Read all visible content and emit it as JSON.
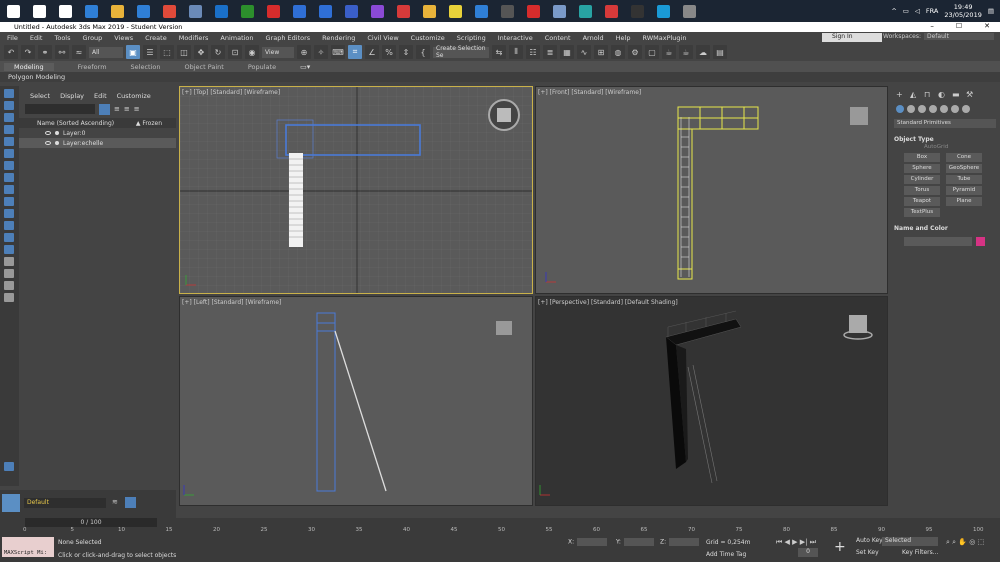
{
  "taskbar": {
    "apps": [
      {
        "icon": "windows-start-icon",
        "color": "#ffffff"
      },
      {
        "icon": "search-icon",
        "color": "#ffffff"
      },
      {
        "icon": "task-view-icon",
        "color": "#ffffff"
      },
      {
        "icon": "edge-icon",
        "color": "#2f7fd6"
      },
      {
        "icon": "file-explorer-icon",
        "color": "#e8b33a"
      },
      {
        "icon": "store-icon",
        "color": "#2f7fd6"
      },
      {
        "icon": "chrome-icon",
        "color": "#e04a3a"
      },
      {
        "icon": "photos-icon",
        "color": "#6a8ab8"
      },
      {
        "icon": "outlook-icon",
        "color": "#1a70c9"
      },
      {
        "icon": "xbox-icon",
        "color": "#2c8f2c"
      },
      {
        "icon": "app-ic-red-icon",
        "color": "#d62c2c"
      },
      {
        "icon": "app-ic-blue-icon",
        "color": "#2f6fd6"
      },
      {
        "icon": "app-ic-blue2-icon",
        "color": "#2f6fd6"
      },
      {
        "icon": "app-infinity-icon",
        "color": "#3a5fc9"
      },
      {
        "icon": "visual-studio-icon",
        "color": "#8a4ad6"
      },
      {
        "icon": "app-red-flame-icon",
        "color": "#d63a3a"
      },
      {
        "icon": "app-yellow-icon",
        "color": "#e8b33a"
      },
      {
        "icon": "app-pikachu-icon",
        "color": "#e8d23a"
      },
      {
        "icon": "app-esu-icon",
        "color": "#2f7fd6"
      },
      {
        "icon": "app-dark-icon",
        "color": "#555555"
      },
      {
        "icon": "acrobat-icon",
        "color": "#d62c2c"
      },
      {
        "icon": "photo-viewer-icon",
        "color": "#7a9ac9"
      },
      {
        "icon": "3dsmax-icon",
        "color": "#28a3a3"
      },
      {
        "icon": "shield-icon",
        "color": "#d63a3a"
      },
      {
        "icon": "terminal-icon",
        "color": "#333333"
      },
      {
        "icon": "skype-icon",
        "color": "#1a9ad6"
      },
      {
        "icon": "settings-icon",
        "color": "#888888"
      }
    ],
    "language": "FRA",
    "time": "19:49",
    "date": "23/05/2019"
  },
  "titlebar": {
    "title": "Untitled - Autodesk 3ds Max 2019 - Student Version"
  },
  "menubar": {
    "items": [
      "File",
      "Edit",
      "Tools",
      "Group",
      "Views",
      "Create",
      "Modifiers",
      "Animation",
      "Graph Editors",
      "Rendering",
      "Civil View",
      "Customize",
      "Scripting",
      "Interactive",
      "Content",
      "Arnold",
      "Help",
      "RWMaxPlugin"
    ],
    "signin": "Sign In",
    "workspaces_label": "Workspaces:",
    "workspace": "Default"
  },
  "toolbar": {
    "filter": "All",
    "refcoord": "View",
    "selection_set": "Create Selection Se"
  },
  "ribbon": {
    "tabs": [
      "Modeling",
      "Freeform",
      "Selection",
      "Object Paint",
      "Populate"
    ],
    "panel": "Polygon Modeling"
  },
  "scene_explorer": {
    "menu": [
      "Select",
      "Display",
      "Edit",
      "Customize"
    ],
    "header_name": "Name (Sorted Ascending)",
    "header_frozen": "▲ Frozen",
    "layers": [
      "Layer:0",
      "Layer:echelle"
    ],
    "active_layer": "Default"
  },
  "viewports": {
    "top": "[+] [Top] [Standard] [Wireframe]",
    "front": "[+] [Front] [Standard] [Wireframe]",
    "left": "[+] [Left] [Standard] [Wireframe]",
    "perspective": "[+] [Perspective] [Standard] [Default Shading]"
  },
  "command_panel": {
    "category": "Standard Primitives",
    "object_type": "Object Type",
    "autogrid": "AutoGrid",
    "primitives": [
      "Box",
      "Cone",
      "Sphere",
      "GeoSphere",
      "Cylinder",
      "Tube",
      "Torus",
      "Pyramid",
      "Teapot",
      "Plane",
      "TextPlus"
    ],
    "name_and_color": "Name and Color",
    "color": "#d63384"
  },
  "timeline": {
    "frame": "0 / 100",
    "ticks": [
      "0",
      "5",
      "10",
      "15",
      "20",
      "25",
      "30",
      "35",
      "40",
      "45",
      "50",
      "55",
      "60",
      "65",
      "70",
      "75",
      "80",
      "85",
      "90",
      "95",
      "100"
    ]
  },
  "status": {
    "maxscript": "MAXScript Mi:",
    "selection": "None Selected",
    "prompt": "Click or click-and-drag to select objects",
    "x_label": "X:",
    "y_label": "Y:",
    "z_label": "Z:",
    "grid": "Grid = 0,254m",
    "add_time_tag": "Add Time Tag",
    "auto_key": "Auto Key",
    "set_key": "Set Key",
    "selected": "Selected",
    "key_filters": "Key Filters...",
    "frame_field": "0"
  }
}
